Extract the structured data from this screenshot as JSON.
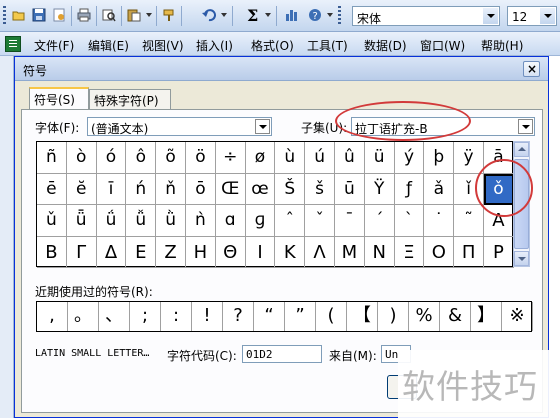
{
  "toolbar": {
    "font_name": "宋体",
    "font_size": "12",
    "sum_symbol": "Σ",
    "icons": [
      "open-icon",
      "save-icon",
      "permission-icon",
      "print-icon",
      "research-icon",
      "paste-icon",
      "undo-icon",
      "autosum-icon",
      "chart-icon",
      "help-icon"
    ]
  },
  "menu": [
    "文件(F)",
    "编辑(E)",
    "视图(V)",
    "插入(I)",
    "格式(O)",
    "工具(T)",
    "数据(D)",
    "窗口(W)",
    "帮助(H)"
  ],
  "dialog": {
    "title": "符号",
    "close_glyph": "×",
    "tabs": [
      {
        "label": "符号(S)",
        "active": true
      },
      {
        "label": "特殊字符(P)",
        "active": false
      }
    ],
    "font_label": "字体(F):",
    "font_value": "(普通文本)",
    "subset_label": "子集(U):",
    "subset_value": "拉丁语扩充-B",
    "symbols": [
      [
        "ñ",
        "ò",
        "ó",
        "ô",
        "õ",
        "ö",
        "÷",
        "ø",
        "ù",
        "ú",
        "û",
        "ü",
        "ý",
        "þ",
        "ÿ",
        "ā"
      ],
      [
        "ē",
        "ĕ",
        "ī",
        "ń",
        "ň",
        "ō",
        "Œ",
        "œ",
        "Š",
        "š",
        "ū",
        "Ÿ",
        "ƒ",
        "ǎ",
        "ǐ",
        "ǒ"
      ],
      [
        "ǔ",
        "ǖ",
        "ǘ",
        "ǚ",
        "ǜ",
        "ǹ",
        "ɑ",
        "ɡ",
        "ˆ",
        "ˇ",
        "ˉ",
        "ˊ",
        "ˋ",
        "˙",
        "˜",
        "Α"
      ],
      [
        "Β",
        "Γ",
        "Δ",
        "Ε",
        "Ζ",
        "Η",
        "Θ",
        "Ι",
        "Κ",
        "Λ",
        "Μ",
        "Ν",
        "Ξ",
        "Ο",
        "Π",
        "Ρ"
      ]
    ],
    "selected_symbol": "ǒ",
    "recent_label": "近期使用过的符号(R):",
    "recent_symbols": [
      ",",
      "。",
      "、",
      ";",
      ":",
      "!",
      "?",
      "“",
      "”",
      "(",
      "【",
      ")",
      "%",
      "&",
      "】",
      "※"
    ],
    "char_name": "LATIN SMALL LETTER…",
    "code_label": "字符代码(C):",
    "code_value": "01D2",
    "from_label": "来自(M):",
    "from_value": "Un"
  },
  "watermark": "软件技巧",
  "colors": {
    "annotation": "#d23a3a",
    "selection": "#316ac5",
    "title_border": "#0831d9"
  }
}
